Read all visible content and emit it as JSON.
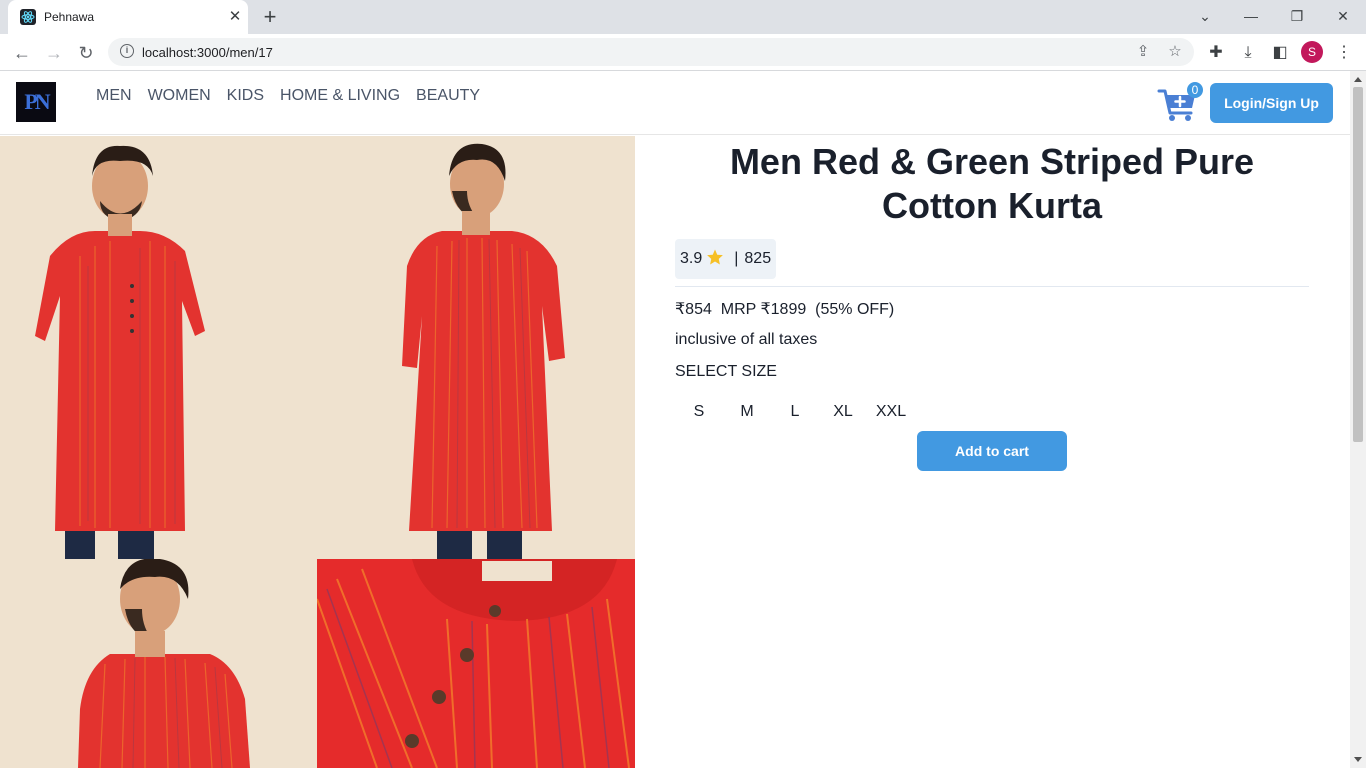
{
  "browser": {
    "tab_title": "Pehnawa",
    "url": "localhost:3000/men/17",
    "profile_initial": "S"
  },
  "header": {
    "logo_text": "PN",
    "nav": [
      "MEN",
      "WOMEN",
      "KIDS",
      "HOME & LIVING",
      "BEAUTY"
    ],
    "cart_count": "0",
    "login_label": "Login/Sign Up"
  },
  "product": {
    "title": "Men Red & Green Striped Pure Cotton Kurta",
    "rating": "3.9",
    "rating_sep": "|",
    "rating_count": "825",
    "price_line": "₹854  MRP ₹1899  (55% OFF)",
    "taxes": "inclusive of all taxes",
    "select_size_label": "SELECT SIZE",
    "sizes": [
      "S",
      "M",
      "L",
      "XL",
      "XXL"
    ],
    "add_to_cart_label": "Add to cart"
  },
  "colors": {
    "accent": "#4299e1",
    "product_red": "#e52b2b",
    "background_beige": "#efe2cf"
  }
}
